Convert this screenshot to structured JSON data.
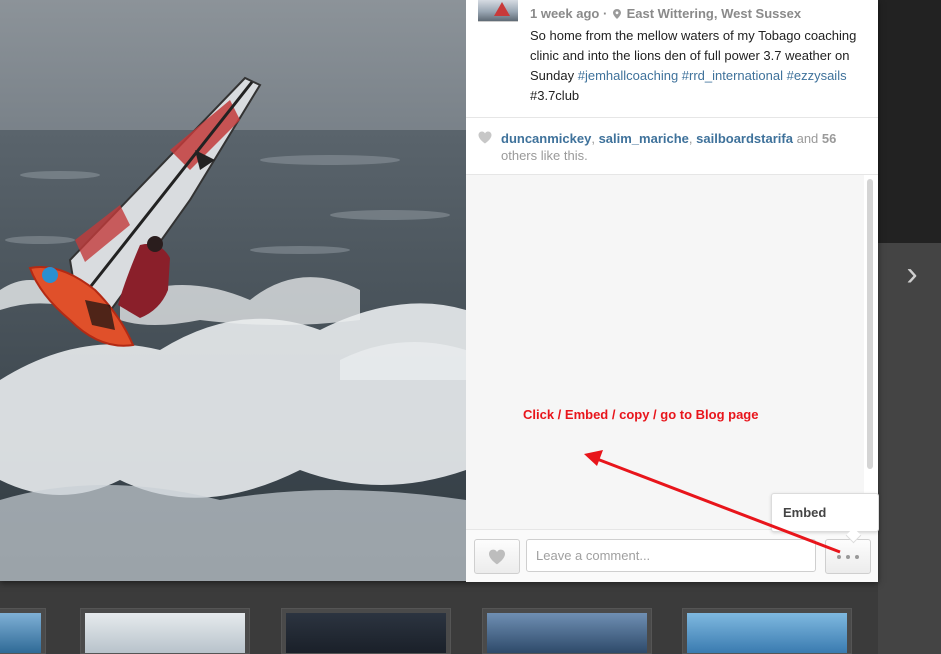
{
  "post": {
    "time_ago": "1 week ago",
    "separator": "·",
    "location": "East Wittering, West Sussex",
    "caption_plain": "So home from the mellow waters of my Tobago coaching clinic and into the lions den of full power 3.7 weather on Sunday",
    "caption_glyph": "",
    "hashtags": [
      "#jemhallcoaching",
      "#rrd_international",
      "#ezzysails"
    ],
    "caption_tail": "#3.7club"
  },
  "likes": {
    "users": [
      "duncanmickey",
      "salim_mariche",
      "sailboardstarifa"
    ],
    "and_text": "and",
    "count": "56",
    "suffix": "others like this."
  },
  "annotation": {
    "text": "Click / Embed / copy / go to Blog page",
    "color": "#e8151b"
  },
  "comment_box": {
    "placeholder": "Leave a comment...",
    "value": ""
  },
  "tooltip": {
    "label": "Embed"
  },
  "icons": {
    "like": "heart-icon",
    "more": "more-dots-icon",
    "next": "chevron-right-icon",
    "location": "location-pin-icon"
  },
  "colors": {
    "link": "#3f729b",
    "annotation": "#e8151b",
    "muted": "#8a8a8a"
  }
}
